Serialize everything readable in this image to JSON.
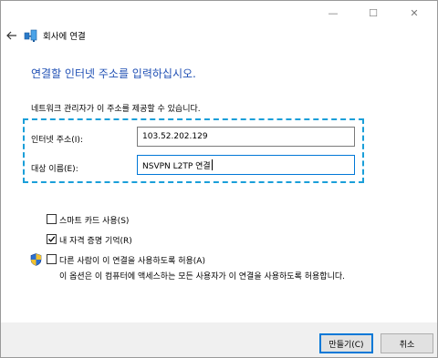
{
  "window": {
    "title": "회사에 연결",
    "controls": {
      "minimize": "—",
      "maximize": "☐",
      "close": "✕"
    }
  },
  "heading": "연결할 인터넷 주소를 입력하십시오.",
  "info": "네트워크 관리자가 이 주소를 제공할 수 있습니다.",
  "fields": {
    "internet_address": {
      "label": "인터넷 주소(I):",
      "value": "103.52.202.129"
    },
    "destination_name": {
      "label": "대상 이름(E):",
      "value": "NSVPN L2TP 연결"
    }
  },
  "options": {
    "smart_card": {
      "label": "스마트 카드 사용(S)",
      "checked": false
    },
    "remember_credentials": {
      "label": "내 자격 증명 기억(R)",
      "checked": true
    },
    "allow_others": {
      "label": "다른 사람이 이 연결을 사용하도록 허용(A)",
      "checked": false
    },
    "allow_others_desc": "이 옵션은 이 컴퓨터에 액세스하는 모든 사용자가 이 연결을 사용하도록 허용합니다."
  },
  "buttons": {
    "create": "만들기(C)",
    "cancel": "취소"
  },
  "colors": {
    "accent": "#0078d7",
    "heading": "#1f4fb4",
    "highlight_border": "#1a9fd9"
  }
}
